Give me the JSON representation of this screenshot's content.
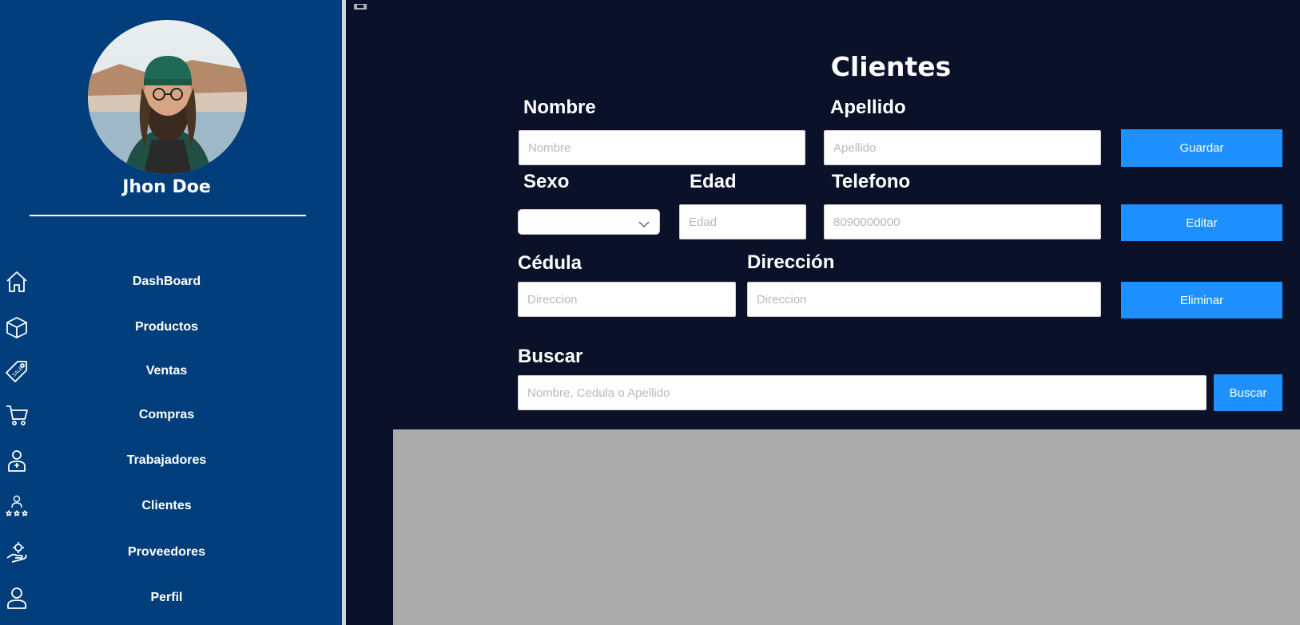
{
  "user": {
    "name": "Jhon Doe"
  },
  "sidebar": {
    "items": [
      {
        "label": "DashBoard",
        "icon": "home-icon"
      },
      {
        "label": "Productos",
        "icon": "box-icon"
      },
      {
        "label": "Ventas",
        "icon": "sale-tag-icon"
      },
      {
        "label": "Compras",
        "icon": "cart-icon"
      },
      {
        "label": "Trabajadores",
        "icon": "worker-icon"
      },
      {
        "label": "Clientes",
        "icon": "clients-rating-icon"
      },
      {
        "label": "Proveedores",
        "icon": "supplier-hand-icon"
      },
      {
        "label": "Perfil",
        "icon": "user-icon"
      }
    ]
  },
  "main": {
    "title": "Clientes",
    "labels": {
      "nombre": "Nombre",
      "apellido": "Apellido",
      "sexo": "Sexo",
      "edad": "Edad",
      "telefono": "Telefono",
      "cedula": "Cédula",
      "direccion": "Dirección",
      "buscar": "Buscar"
    },
    "placeholders": {
      "nombre": "Nombre",
      "apellido": "Apellido",
      "edad": "Edad",
      "telefono": "8090000000",
      "cedula": "Direccion",
      "direccion": "Direccion",
      "buscar": "Nombre, Cedula o Apellido"
    },
    "sexo_value": "",
    "buttons": {
      "guardar": "Guardar",
      "editar": "Editar",
      "eliminar": "Eliminar",
      "buscar": "Buscar"
    }
  },
  "colors": {
    "sidebar_bg": "#023e7b",
    "main_bg": "#0b1129",
    "accent": "#1e90ff",
    "results_bg": "#ababab"
  }
}
